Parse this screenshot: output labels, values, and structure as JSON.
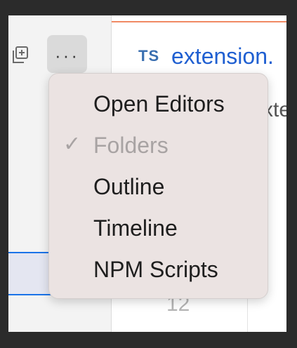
{
  "editor": {
    "tab_lang": "TS",
    "tab_title": "extension.",
    "breadcrumb": "xte",
    "line_number": "12"
  },
  "sidebar": {
    "more_label": "···"
  },
  "menu": {
    "items": [
      {
        "label": "Open Editors",
        "checked": false
      },
      {
        "label": "Folders",
        "checked": true,
        "check_glyph": "✓"
      },
      {
        "label": "Outline",
        "checked": false
      },
      {
        "label": "Timeline",
        "checked": false
      },
      {
        "label": "NPM Scripts",
        "checked": false
      }
    ]
  },
  "colors": {
    "accent": "#1a73e8",
    "tab_border": "#f08a64",
    "menu_bg": "#ebe3e2",
    "disabled_text": "#a8a3a3"
  }
}
